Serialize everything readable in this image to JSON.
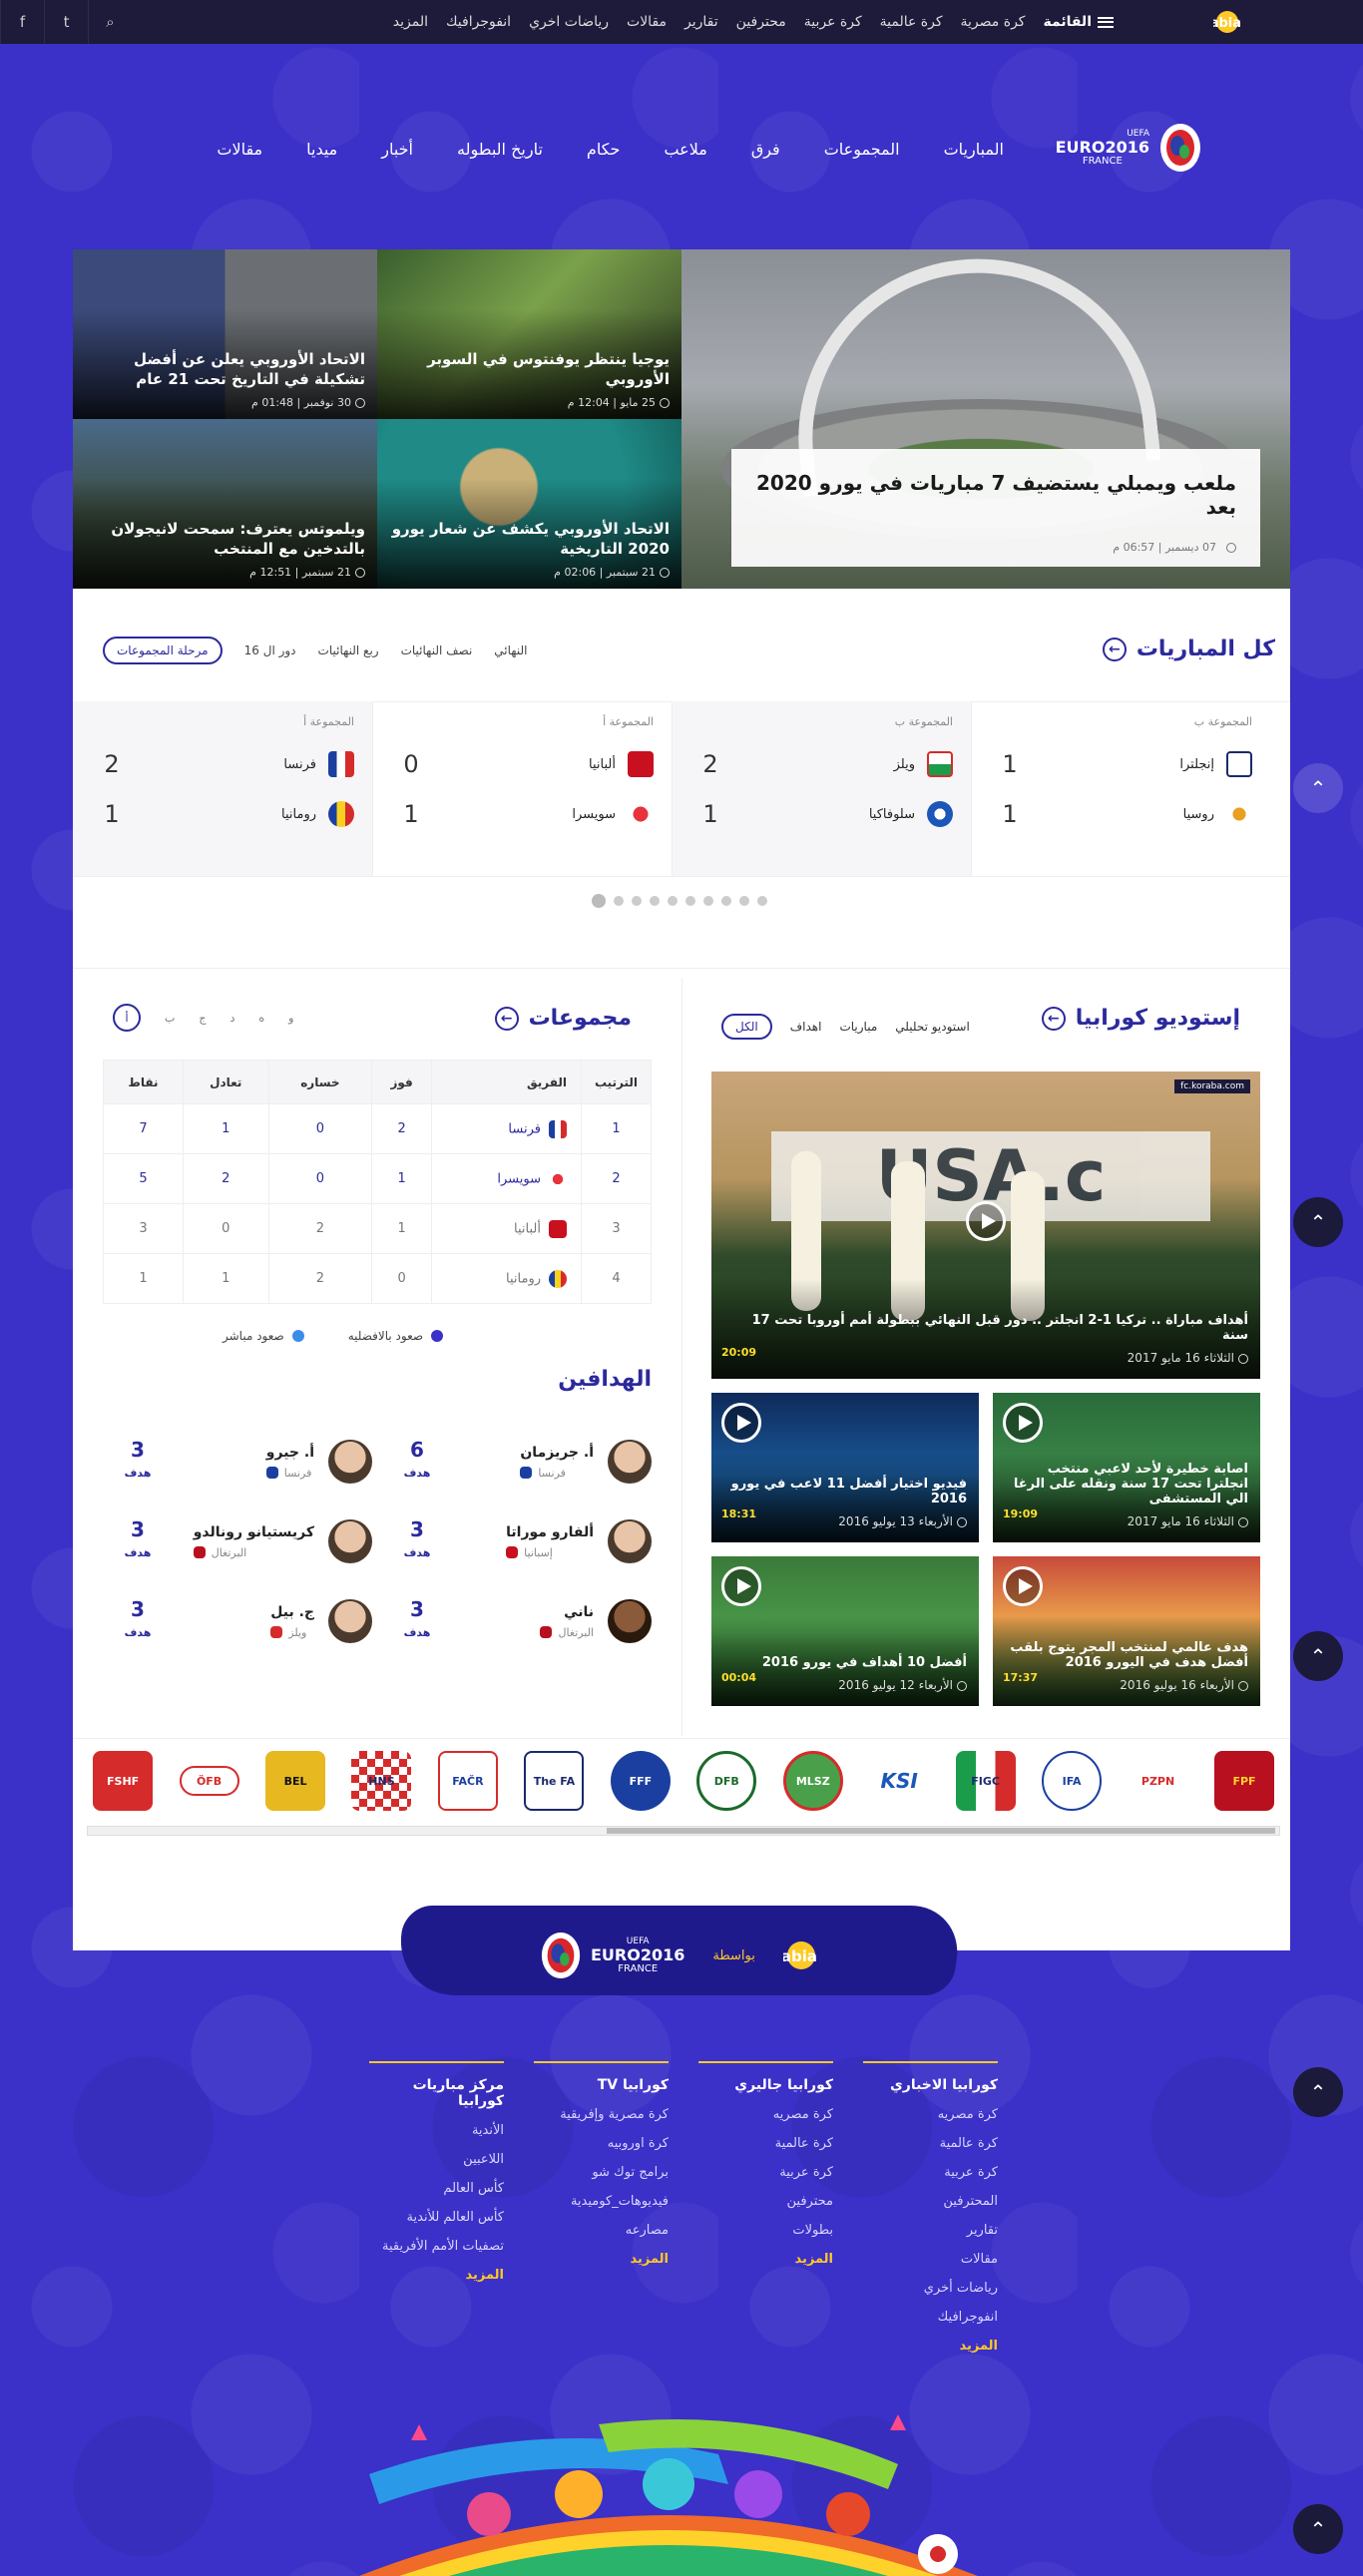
{
  "topbar": {
    "menu_label": "القائمة",
    "menu": [
      "كرة مصرية",
      "كرة عالمية",
      "كرة عربية",
      "محترفين",
      "تقارير",
      "مقالات",
      "رياضات اخري",
      "انفوجرافيك",
      "المزيد"
    ],
    "social": [
      "facebook-icon",
      "twitter-icon",
      "search-icon"
    ]
  },
  "brand": {
    "euro_text": "EURO2016",
    "euro_sub": "FRANCE",
    "uefa": "UEFA",
    "colors": {
      "primary": "#3a2fc4",
      "dark": "#1d1a3a",
      "accent": "#ffc926"
    }
  },
  "mainnav": [
    "المباريات",
    "المجموعات",
    "فرق",
    "ملاعب",
    "حكام",
    "تاريخ البطوله",
    "أخبار",
    "ميديا",
    "مقالات"
  ],
  "hero": {
    "main": {
      "title": "ملعب ويمبلي يستضيف 7 مباريات في يورو 2020 بعد",
      "date": "07 ديسمبر | 06:57 م"
    },
    "tiles": [
      {
        "title": "يوجيا ينتظر يوفنتوس في السوبر الأوروبي",
        "date": "25 مايو | 12:04 م"
      },
      {
        "title": "الاتحاد الأوروبي يعلن عن أفضل تشكيلة في التاريخ تحت 21 عام",
        "date": "30 نوفمبر | 01:48 م"
      },
      {
        "title": "الاتحاد الأوروبي يكشف عن شعار يورو 2020 التاريخية",
        "date": "21 سبتمبر | 02:06 م"
      },
      {
        "title": "ويلموتس يعترف: سمحت لانيجولان بالتدخين مع المنتخب",
        "date": "21 سبتمبر | 12:51 م"
      }
    ]
  },
  "matches": {
    "title": "كل المباريات",
    "stages": [
      "مرحلة المجموعات",
      "دور ال 16",
      "ربع النهائيات",
      "نصف النهائيات",
      "النهائي"
    ],
    "list": [
      {
        "group": "المجموعة أ",
        "home": "فرنسا",
        "home_score": "2",
        "away": "رومانيا",
        "away_score": "1"
      },
      {
        "group": "المجموعة أ",
        "home": "ألبانيا",
        "home_score": "0",
        "away": "سويسرا",
        "away_score": "1"
      },
      {
        "group": "المجموعة ب",
        "home": "ويلز",
        "home_score": "2",
        "away": "سلوفاكيا",
        "away_score": "1"
      },
      {
        "group": "المجموعة ب",
        "home": "إنجلترا",
        "home_score": "1",
        "away": "روسيا",
        "away_score": "1"
      }
    ]
  },
  "studio": {
    "title": "إستوديو كورابيا",
    "filters": [
      "الكل",
      "اهداف",
      "مباريات",
      "استوديو تحليلي"
    ],
    "main": {
      "title": "أهداف مباراة .. تركيا 1-2 انجلتر .. دور قبل النهائي ببطولة أمم أوروبا تحت 17 سنة",
      "date": "الثلاثاء 16 مايو 2017",
      "duration": "20:09",
      "channel": "fc.koraba.com"
    },
    "videos": [
      {
        "title": "اصابة خطيرة لأحد لاعبي منتخب انجلترا تحت 17 سنة ونقله على الرغا الي المستشفى",
        "date": "الثلاثاء 16 مايو 2017",
        "duration": "19:09"
      },
      {
        "title": "فيديو اختيار أفضل 11 لاعب في يورو 2016",
        "date": "الأربعاء 13 يوليو 2016",
        "duration": "18:31"
      },
      {
        "title": "هدف عالمي لمنتخب المجر يتوج بلقب أفضل هدف في اليورو 2016",
        "date": "الأربعاء 16 يوليو 2016",
        "duration": "17:37"
      },
      {
        "title": "أفضل 10 أهداف في يورو 2016",
        "date": "الأربعاء 12 يوليو 2016",
        "duration": "00:04"
      }
    ]
  },
  "groups": {
    "title": "مجموعات",
    "tabs": [
      "أ",
      "ب",
      "ج",
      "د",
      "ه",
      "و"
    ],
    "headers": [
      "الترتيب",
      "الفريق",
      "فوز",
      "خساره",
      "تعادل",
      "نقاط"
    ],
    "rows": [
      {
        "rank": "1",
        "team": "فرنسا",
        "w": "2",
        "l": "0",
        "d": "1",
        "pts": "7",
        "q": true
      },
      {
        "rank": "2",
        "team": "سويسرا",
        "w": "1",
        "l": "0",
        "d": "2",
        "pts": "5",
        "q": true
      },
      {
        "rank": "3",
        "team": "ألبانيا",
        "w": "1",
        "l": "2",
        "d": "0",
        "pts": "3",
        "q": false
      },
      {
        "rank": "4",
        "team": "رومانيا",
        "w": "0",
        "l": "2",
        "d": "1",
        "pts": "1",
        "q": false
      }
    ],
    "legend": [
      "صعود بالافضليه",
      "صعود مباشر"
    ]
  },
  "scorers": {
    "title": "الهدافين",
    "unit": "هدف",
    "list": [
      {
        "name": "أ. جريزمان",
        "country": "فرنسا",
        "goals": "6"
      },
      {
        "name": "أ. جيرو",
        "country": "فرنسا",
        "goals": "3"
      },
      {
        "name": "ألفارو موراتا",
        "country": "إسبانيا",
        "goals": "3"
      },
      {
        "name": "كريستيانو رونالدو",
        "country": "البرتغال",
        "goals": "3"
      },
      {
        "name": "ناني",
        "country": "البرتغال",
        "goals": "3"
      },
      {
        "name": "ج. بيل",
        "country": "ويلز",
        "goals": "3"
      }
    ]
  },
  "crests": [
    "FSHF",
    "ÖFB",
    "BEL",
    "HNS",
    "FAČR",
    "The FA",
    "FFF",
    "DFB",
    "MLSZ",
    "KSI",
    "FIGC",
    "IFA",
    "PZPN",
    "FPF"
  ],
  "footer": {
    "by": "بواسطة",
    "columns": [
      {
        "title": "كورابيا الاخباري",
        "links": [
          "كرة مصريه",
          "كرة عالمية",
          "كرة عربية",
          "المحترفين",
          "تقارير",
          "مقالات",
          "رياضات أخري",
          "انفوجرافيك",
          "المزيد"
        ]
      },
      {
        "title": "كورابيا جاليري",
        "links": [
          "كرة مصريه",
          "كرة عالمية",
          "كرة عربية",
          "محترفين",
          "بطولات",
          "المزيد"
        ]
      },
      {
        "title": "كورابيا TV",
        "links": [
          "كرة مصرية وإفريقية",
          "كرة اوروبيه",
          "برامج توك شو",
          "فيديوهات_كوميدية",
          "مصارعه",
          "المزيد"
        ]
      },
      {
        "title": "مركز مباريات كورابيا",
        "links": [
          "الأندية",
          "اللاعبين",
          "كأس العالم",
          "كأس العالم للأندية",
          "تصفيات الأمم الأفريقية",
          "المزيد"
        ]
      }
    ]
  }
}
